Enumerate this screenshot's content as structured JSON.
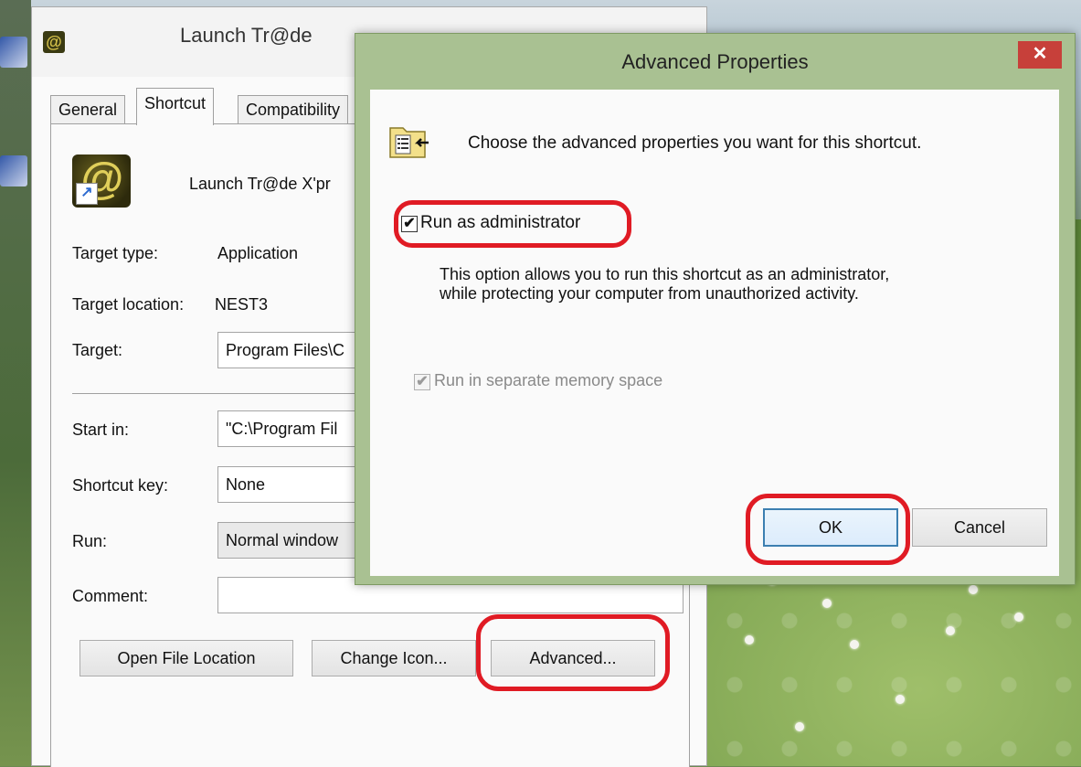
{
  "desktop": {
    "wallpaper": "meadow-with-dandelions"
  },
  "properties_window": {
    "title": "Launch Tr@de ",
    "tabs": [
      {
        "label": "General"
      },
      {
        "label": "Shortcut"
      },
      {
        "label": "Compatibility"
      }
    ],
    "shortcut_name": "Launch Tr@de X'pr",
    "fields": {
      "target_type_label": "Target type:",
      "target_type_value": "Application",
      "target_location_label": "Target location:",
      "target_location_value": "NEST3",
      "target_label": "Target:",
      "target_value": "Program Files\\C",
      "start_in_label": "Start in:",
      "start_in_value": "\"C:\\Program Fil",
      "shortcut_key_label": "Shortcut key:",
      "shortcut_key_value": "None",
      "run_label": "Run:",
      "run_value": "Normal window",
      "comment_label": "Comment:",
      "comment_value": ""
    },
    "buttons": {
      "open_file_location": "Open File Location",
      "change_icon": "Change Icon...",
      "advanced": "Advanced..."
    }
  },
  "advanced_dialog": {
    "title": "Advanced Properties",
    "close_glyph": "✕",
    "heading": "Choose the advanced properties you want for this shortcut.",
    "run_as_admin": {
      "label": "Run as administrator",
      "checked": true
    },
    "description": "This option allows you to run this shortcut as an administrator, while protecting your computer from unauthorized activity.",
    "separate_memory": {
      "label": "Run in separate memory space",
      "checked": true,
      "enabled": false
    },
    "ok_label": "OK",
    "cancel_label": "Cancel"
  },
  "check_glyph": "✔",
  "colors": {
    "highlight": "#e01b24",
    "dialog_frame": "#a9c192",
    "close_button": "#c7403a",
    "ok_border": "#3c7fb1"
  }
}
